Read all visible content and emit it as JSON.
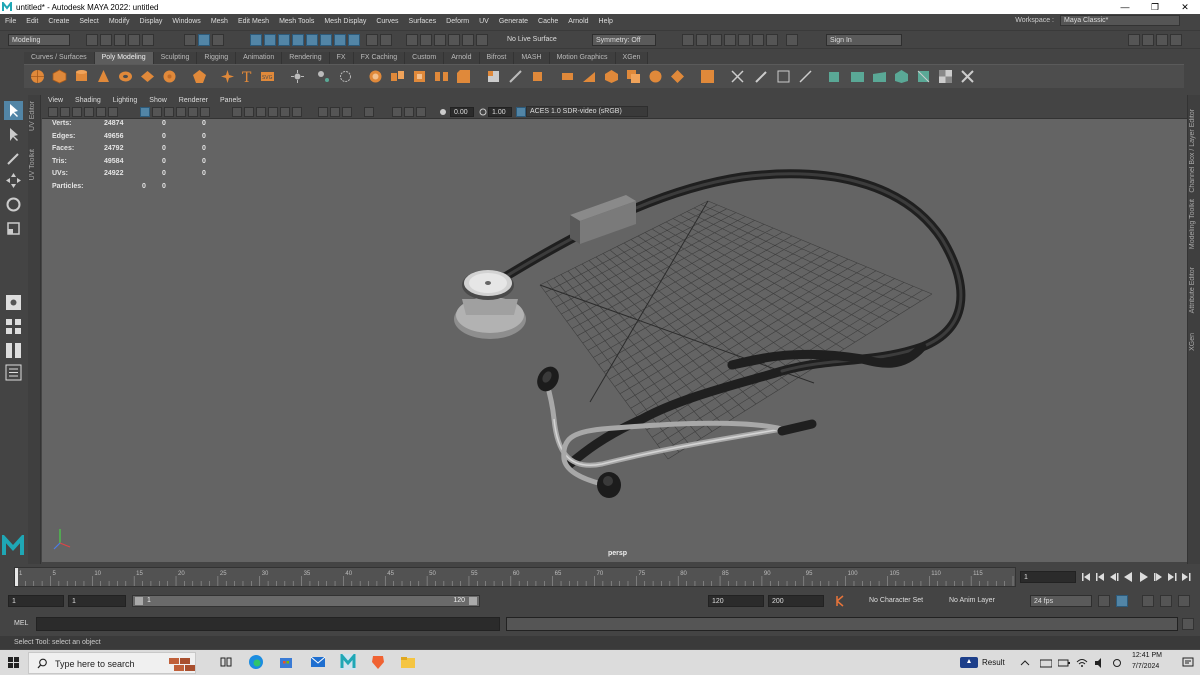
{
  "window": {
    "title": "untitled* - Autodesk MAYA 2022: untitled",
    "minimize": "—",
    "maximize": "❐",
    "close": "✕"
  },
  "menubar": {
    "items": [
      "File",
      "Edit",
      "Create",
      "Select",
      "Modify",
      "Display",
      "Windows",
      "Mesh",
      "Edit Mesh",
      "Mesh Tools",
      "Mesh Display",
      "Curves",
      "Surfaces",
      "Deform",
      "UV",
      "Generate",
      "Cache",
      "Arnold",
      "Help"
    ]
  },
  "workspace": {
    "label": "Workspace :",
    "value": "Maya Classic*"
  },
  "statusline": {
    "menuset": "Modeling",
    "live_surface": "No Live Surface",
    "symmetry": "Symmetry: Off",
    "sign_in": "Sign In"
  },
  "shelf": {
    "tabs": [
      "Curves / Surfaces",
      "Poly Modeling",
      "Sculpting",
      "Rigging",
      "Animation",
      "Rendering",
      "FX",
      "FX Caching",
      "Custom",
      "Arnold",
      "Bifrost",
      "MASH",
      "Motion Graphics",
      "XGen"
    ],
    "active_tab": "Poly Modeling"
  },
  "side_labels": {
    "left": [
      "UV Editor",
      "UV Toolkit"
    ],
    "right": [
      "Channel Box / Layer Editor",
      "Modeling Toolkit",
      "Attribute Editor",
      "XGen"
    ]
  },
  "viewport": {
    "menus": [
      "View",
      "Shading",
      "Lighting",
      "Show",
      "Renderer",
      "Panels"
    ],
    "exposure": "0.00",
    "gamma": "1.00",
    "color_space": "ACES 1.0 SDR-video (sRGB)",
    "camera": "persp"
  },
  "hud": [
    {
      "label": "Verts:",
      "a": "24874",
      "b": "0",
      "c": "0"
    },
    {
      "label": "Edges:",
      "a": "49656",
      "b": "0",
      "c": "0"
    },
    {
      "label": "Faces:",
      "a": "24792",
      "b": "0",
      "c": "0"
    },
    {
      "label": "Tris:",
      "a": "49584",
      "b": "0",
      "c": "0"
    },
    {
      "label": "UVs:",
      "a": "24922",
      "b": "0",
      "c": "0"
    },
    {
      "label": "Particles:",
      "a": "0",
      "b": "0",
      "c": ""
    }
  ],
  "timeline": {
    "ticks": [
      "1",
      "5",
      "10",
      "15",
      "20",
      "25",
      "30",
      "35",
      "40",
      "45",
      "50",
      "55",
      "60",
      "65",
      "70",
      "75",
      "80",
      "85",
      "90",
      "95",
      "100",
      "105",
      "110",
      "115",
      "120"
    ],
    "current_frame": "1",
    "start": "1",
    "playback_start": "1",
    "range_start": "1",
    "range_end": "120",
    "playback_end": "120",
    "end": "200",
    "character_set": "No Character Set",
    "anim_layer": "No Anim Layer",
    "fps": "24 fps"
  },
  "commandline": {
    "lang": "MEL",
    "help": "Select Tool: select an object"
  },
  "taskbar": {
    "search_placeholder": "Type here to search",
    "result": "Result",
    "time": "12:41 PM",
    "date": "7/7/2024"
  },
  "colors": {
    "viewport_bg": "#646464",
    "selected_tool": "#5285a6",
    "shelf_icon": "#e0893a",
    "shelf_icon_green": "#5aa896",
    "maya_logo": "#1fa7b5"
  }
}
